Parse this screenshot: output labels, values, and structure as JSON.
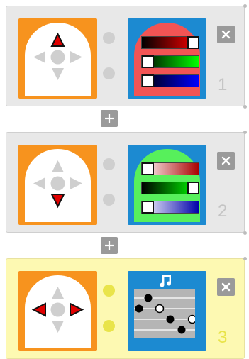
{
  "colors": {
    "dock_orange": "#f7931e",
    "node_blue": "#1c8ad1",
    "card_grey": "#e8e8e8",
    "card_yellow": "#fdf9b2",
    "arrow_red": "#e00000",
    "arrow_grey": "#cfcfcf",
    "dot_grey": "#cfcfcf",
    "dot_yellow": "#e9e44a",
    "button_grey": "#9a9a9a"
  },
  "icons": {
    "close": "close-icon",
    "add": "plus-icon",
    "music": "music-note-icon"
  },
  "cards": [
    {
      "number": "1",
      "active_direction": "up",
      "node_type": "color-sliders",
      "node_bg": "#f25454",
      "sliders": [
        {
          "gradient": [
            "#000000",
            "#ff0000"
          ],
          "level": 0.86
        },
        {
          "gradient": [
            "#000000",
            "#00ff00"
          ],
          "level": 0.0
        },
        {
          "gradient": [
            "#000000",
            "#0000ff"
          ],
          "level": 0.0
        }
      ]
    },
    {
      "number": "2",
      "active_direction": "down",
      "node_type": "color-sliders",
      "node_bg": "#57f05b",
      "sliders": [
        {
          "gradient": [
            "#ffffff",
            "#aa0000"
          ],
          "level": 0.0
        },
        {
          "gradient": [
            "#000000",
            "#00ff00"
          ],
          "level": 0.86
        },
        {
          "gradient": [
            "#ffffff",
            "#0000aa"
          ],
          "level": 0.0
        }
      ]
    },
    {
      "number": "3",
      "active_direction": "left-right",
      "node_type": "music",
      "node_bg": "#1c8ad1",
      "notes": [
        {
          "filled": true
        },
        {
          "filled": true
        },
        {
          "filled": false
        },
        {
          "filled": true
        },
        {
          "filled": false
        },
        {
          "filled": true
        }
      ]
    }
  ]
}
